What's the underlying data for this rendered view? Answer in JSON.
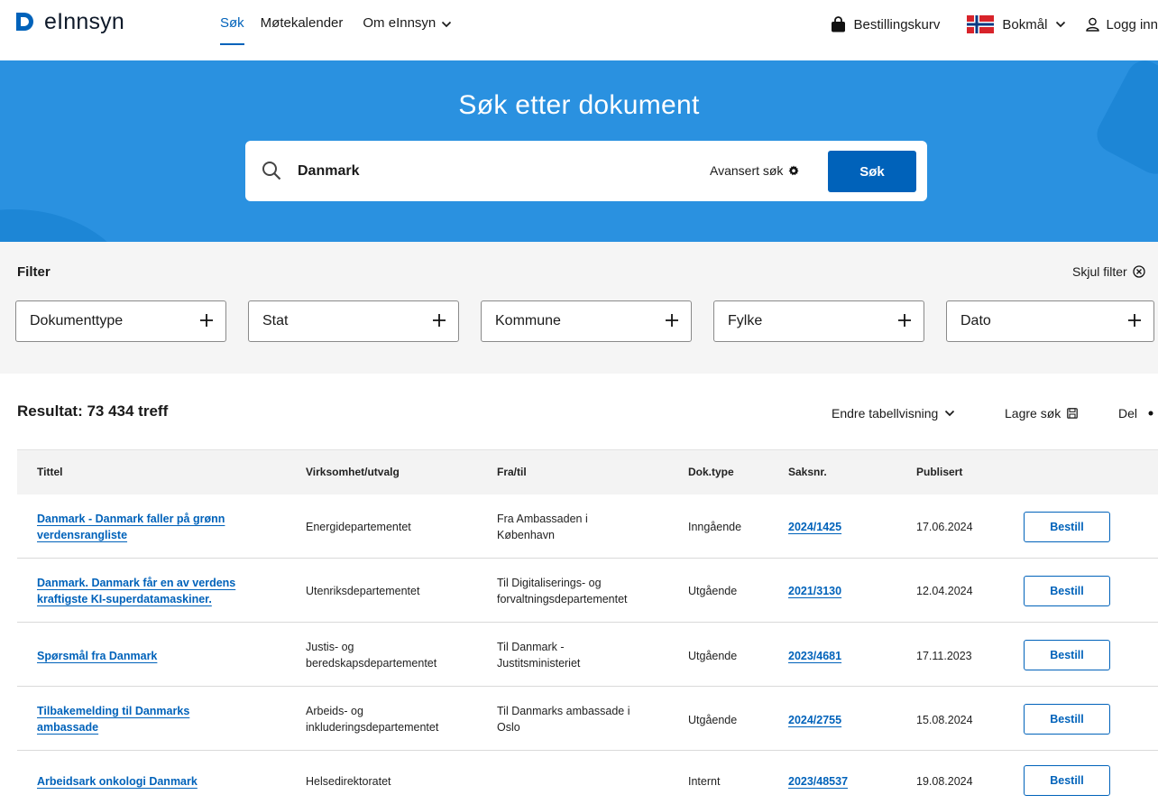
{
  "header": {
    "logo_text": "eInnsyn",
    "nav": [
      {
        "label": "Søk",
        "active": true
      },
      {
        "label": "Møtekalender"
      },
      {
        "label": "Om eInnsyn"
      }
    ],
    "cart_label": "Bestillingskurv",
    "language_label": "Bokmål",
    "login_label": "Logg inn"
  },
  "hero": {
    "title": "Søk etter dokument",
    "search_value": "Danmark",
    "advanced_label": "Avansert søk",
    "search_button": "Søk"
  },
  "filter": {
    "title": "Filter",
    "hide_label": "Skjul filter",
    "boxes": [
      "Dokumenttype",
      "Stat",
      "Kommune",
      "Fylke",
      "Dato"
    ]
  },
  "results": {
    "count_label": "Resultat: 73 434 treff",
    "change_view_label": "Endre tabellvisning",
    "save_search_label": "Lagre søk",
    "share_label": "Del"
  },
  "table": {
    "headers": [
      "Tittel",
      "Virksomhet/utvalg",
      "Fra/til",
      "Dok.type",
      "Saksnr.",
      "Publisert"
    ],
    "rows": [
      {
        "title_1": "Danmark - Danmark faller på grønn",
        "title_2": "verdensrangliste",
        "virksomhet_1": "Energidepartementet",
        "virksomhet_2": "",
        "fratil_1": "Fra Ambassaden i",
        "fratil_2": "København",
        "doktype": "Inngående",
        "saksnr": "2024/1425",
        "publisert": "17.06.2024",
        "action": "Bestill"
      },
      {
        "title_1": "Danmark. Danmark får en av verdens",
        "title_2": "kraftigste KI-superdatamaskiner.",
        "virksomhet_1": "Utenriksdepartementet",
        "virksomhet_2": "",
        "fratil_1": "Til Digitaliserings- og",
        "fratil_2": "forvaltningsdepartementet",
        "doktype": "Utgående",
        "saksnr": "2021/3130",
        "publisert": "12.04.2024",
        "action": "Bestill"
      },
      {
        "title_1": "Spørsmål fra Danmark",
        "title_2": "",
        "virksomhet_1": "Justis- og",
        "virksomhet_2": "beredskapsdepartementet",
        "fratil_1": "Til Danmark -",
        "fratil_2": "Justitsministeriet",
        "doktype": "Utgående",
        "saksnr": "2023/4681",
        "publisert": "17.11.2023",
        "action": "Bestill"
      },
      {
        "title_1": "Tilbakemelding til Danmarks",
        "title_2": "ambassade",
        "virksomhet_1": "Arbeids- og",
        "virksomhet_2": "inkluderingsdepartementet",
        "fratil_1": "Til Danmarks ambassade i",
        "fratil_2": "Oslo",
        "doktype": "Utgående",
        "saksnr": "2024/2755",
        "publisert": "15.08.2024",
        "action": "Bestill"
      },
      {
        "title_1": "Arbeidsark onkologi Danmark",
        "title_2": "",
        "virksomhet_1": "Helsedirektoratet",
        "virksomhet_2": "",
        "fratil_1": "",
        "fratil_2": "",
        "doktype": "Internt",
        "saksnr": "2023/48537",
        "publisert": "19.08.2024",
        "action": "Bestill"
      }
    ]
  },
  "colors": {
    "brand_blue": "#0062ba",
    "hero_blue": "#2a91e0",
    "filter_bg": "#f5f5f5"
  },
  "icons": [
    "logo-d-icon",
    "chevron-down-icon",
    "shopping-bag-icon",
    "norway-flag-icon",
    "user-icon",
    "search-icon",
    "gear-icon",
    "close-circle-icon",
    "plus-icon",
    "save-icon",
    "share-icon"
  ]
}
